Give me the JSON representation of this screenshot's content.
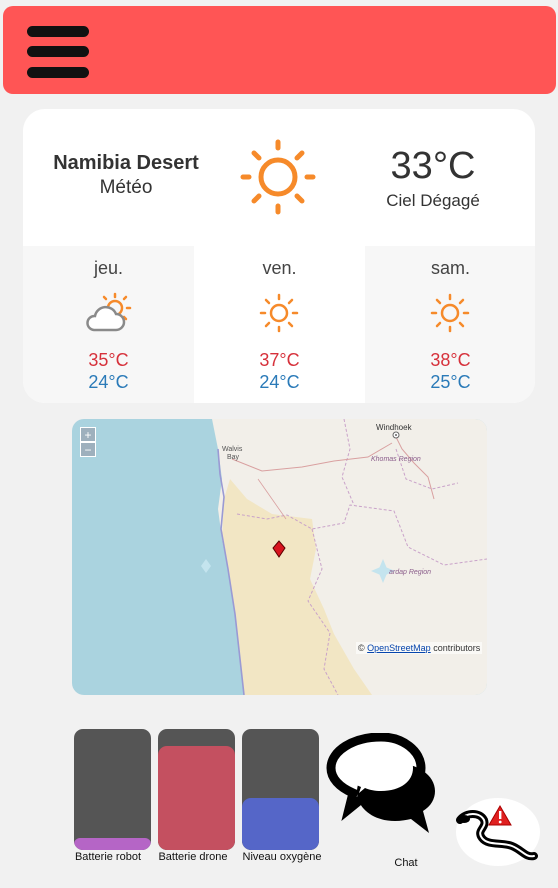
{
  "header": {
    "menu_icon": "hamburger-menu-icon",
    "color": "#ff5555"
  },
  "weather": {
    "location": "Namibia Desert",
    "subtitle": "Météo",
    "current_icon": "sun-icon",
    "temperature": "33°C",
    "description": "Ciel Dégagé",
    "forecast": [
      {
        "day": "jeu.",
        "icon": "partly-cloudy-icon",
        "high": "35°C",
        "low": "24°C"
      },
      {
        "day": "ven.",
        "icon": "sun-icon",
        "high": "37°C",
        "low": "24°C"
      },
      {
        "day": "sam.",
        "icon": "sun-icon",
        "high": "38°C",
        "low": "25°C"
      }
    ],
    "colors": {
      "sun": "#f68a2a",
      "high": "#d6313b",
      "low": "#2a7ab8"
    }
  },
  "map": {
    "zoom_in": "+",
    "zoom_out": "−",
    "labels": {
      "walvis": "Walvis",
      "bay": "Bay",
      "windhoek": "Windhoek",
      "khomas": "Khomas Region",
      "hardap": "ardap Region"
    },
    "attribution": {
      "prefix": "©",
      "link": "OpenStreetMap",
      "suffix": "contributors"
    }
  },
  "status": {
    "gauges": [
      {
        "label": "Batterie robot",
        "level": 0.1,
        "color": "#b565c6"
      },
      {
        "label": "Batterie drone",
        "level": 0.86,
        "color": "#c45060"
      },
      {
        "label": "Niveau oxygène",
        "level": 0.43,
        "color": "#5566c8"
      }
    ],
    "chat": {
      "label": "Chat",
      "icon": "chat-bubbles-icon"
    },
    "alert": {
      "icon": "snake-warning-icon",
      "color": "#e02020"
    }
  }
}
